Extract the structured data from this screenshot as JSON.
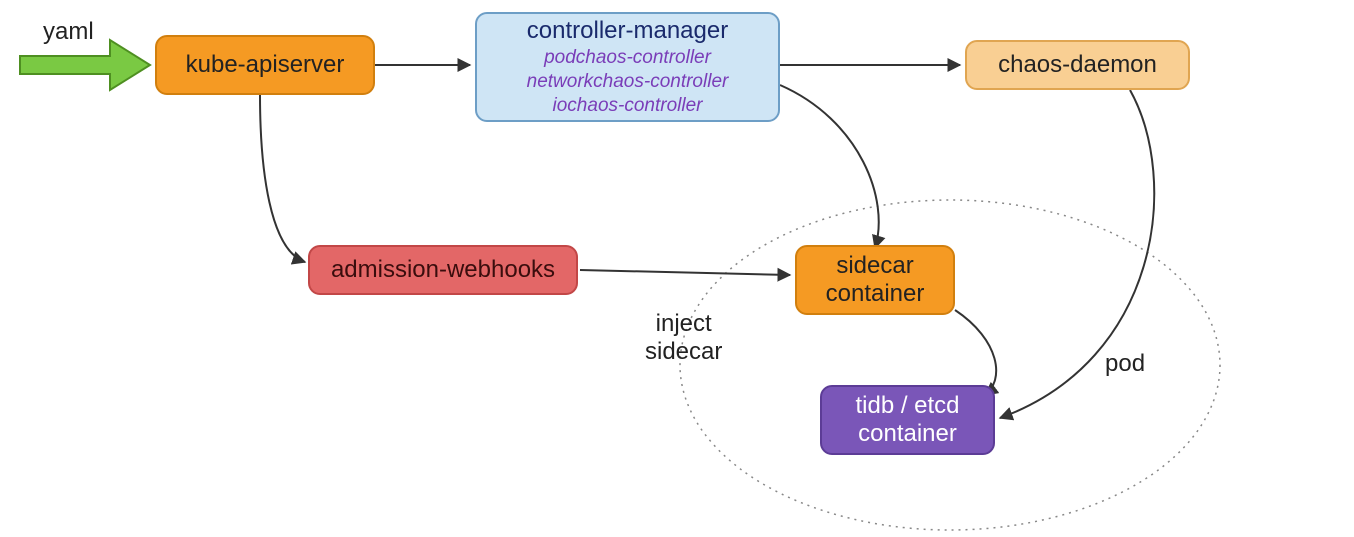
{
  "labels": {
    "yaml": "yaml",
    "inject_sidecar_line1": "inject",
    "inject_sidecar_line2": "sidecar",
    "pod": "pod"
  },
  "nodes": {
    "kube_apiserver": {
      "text": "kube-apiserver",
      "fill": "#f59a23",
      "stroke": "#d17f0e"
    },
    "controller_manager": {
      "title": "controller-manager",
      "lines": [
        "podchaos-controller",
        "networkchaos-controller",
        "iochaos-controller"
      ],
      "fill": "#cfe5f5",
      "stroke": "#6d9ec6",
      "title_color": "#1a2a6c"
    },
    "chaos_daemon": {
      "text": "chaos-daemon",
      "fill": "#f9cf93",
      "stroke": "#e0a551"
    },
    "admission_webhooks": {
      "text": "admission-webhooks",
      "fill": "#e36767",
      "stroke": "#c24747",
      "text_color": "#3a0d0d"
    },
    "sidecar_container": {
      "line1": "sidecar",
      "line2": "container",
      "fill": "#f59a23",
      "stroke": "#d17f0e"
    },
    "tidb_etcd_container": {
      "line1": "tidb / etcd",
      "line2": "container",
      "fill": "#7a56b8",
      "stroke": "#5c3c96",
      "text_color": "#ffffff"
    }
  },
  "edges": [
    {
      "from": "yaml-arrow",
      "to": "kube_apiserver"
    },
    {
      "from": "kube_apiserver",
      "to": "controller_manager"
    },
    {
      "from": "kube_apiserver",
      "to": "admission_webhooks"
    },
    {
      "from": "controller_manager",
      "to": "chaos_daemon"
    },
    {
      "from": "controller_manager",
      "to": "sidecar_container"
    },
    {
      "from": "admission_webhooks",
      "to": "sidecar_container",
      "label": "inject sidecar"
    },
    {
      "from": "chaos_daemon",
      "to": "tidb_etcd_container"
    },
    {
      "from": "sidecar_container",
      "to": "tidb_etcd_container"
    }
  ],
  "groups": {
    "pod": [
      "sidecar_container",
      "tidb_etcd_container"
    ]
  }
}
